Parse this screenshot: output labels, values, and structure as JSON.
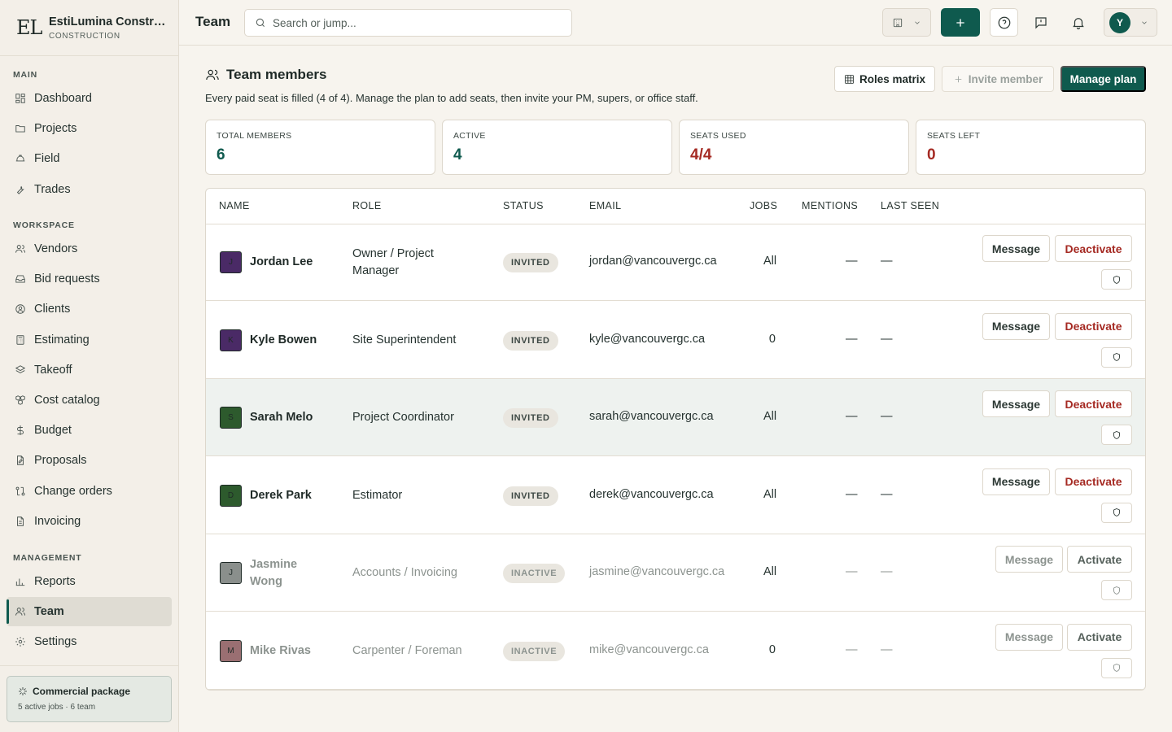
{
  "brand": {
    "logo": "EL",
    "name": "EstiLumina Construction",
    "sub": "CONSTRUCTION"
  },
  "sidebar": {
    "sections": [
      {
        "label": "MAIN",
        "items": [
          {
            "label": "Dashboard",
            "icon": "grid-icon"
          },
          {
            "label": "Projects",
            "icon": "folder-icon"
          },
          {
            "label": "Field",
            "icon": "hard-hat-icon"
          },
          {
            "label": "Trades",
            "icon": "wrench-icon"
          }
        ]
      },
      {
        "label": "WORKSPACE",
        "items": [
          {
            "label": "Vendors",
            "icon": "users-icon"
          },
          {
            "label": "Bid requests",
            "icon": "inbox-icon"
          },
          {
            "label": "Clients",
            "icon": "user-circle-icon"
          },
          {
            "label": "Estimating",
            "icon": "calculator-icon"
          },
          {
            "label": "Takeoff",
            "icon": "layers-icon"
          },
          {
            "label": "Cost catalog",
            "icon": "boxes-icon"
          },
          {
            "label": "Budget",
            "icon": "dollar-icon"
          },
          {
            "label": "Proposals",
            "icon": "file-pen-icon"
          },
          {
            "label": "Change orders",
            "icon": "git-compare-icon"
          },
          {
            "label": "Invoicing",
            "icon": "file-text-icon"
          }
        ]
      },
      {
        "label": "MANAGEMENT",
        "items": [
          {
            "label": "Reports",
            "icon": "bar-chart-icon"
          },
          {
            "label": "Team",
            "icon": "users-icon",
            "active": true
          },
          {
            "label": "Settings",
            "icon": "gear-icon"
          }
        ]
      }
    ],
    "package": {
      "title": "Commercial package",
      "sub": "5 active jobs · 6 team"
    }
  },
  "topbar": {
    "title": "Team",
    "search_placeholder": "Search or jump...",
    "user_initial": "Y"
  },
  "page": {
    "title": "Team members",
    "description": "Every paid seat is filled (4 of 4). Manage the plan to add seats, then invite your PM, supers, or office staff.",
    "roles_label": "Roles matrix",
    "invite_label": "Invite member",
    "manage_label": "Manage plan"
  },
  "stats": [
    {
      "label": "TOTAL MEMBERS",
      "value": "6",
      "color": "#0f5a4e"
    },
    {
      "label": "ACTIVE",
      "value": "4",
      "color": "#0f5a4e"
    },
    {
      "label": "SEATS USED",
      "value": "4/4",
      "color": "#a52a23"
    },
    {
      "label": "SEATS LEFT",
      "value": "0",
      "color": "#a52a23"
    }
  ],
  "table": {
    "headers": {
      "name": "NAME",
      "role": "ROLE",
      "status": "STATUS",
      "email": "EMAIL",
      "jobs": "JOBS",
      "mentions": "MENTIONS",
      "last_seen": "LAST SEEN"
    },
    "rows": [
      {
        "initial": "J",
        "name": "Jordan Lee",
        "role": "Owner / Project Manager",
        "status": "INVITED",
        "email": "jordan@vancouvergc.ca",
        "jobs": "All",
        "mentions": "—",
        "last_seen": "—",
        "message": "Message",
        "action": "Deactivate",
        "avatar_color": "#4a2a66"
      },
      {
        "initial": "K",
        "name": "Kyle Bowen",
        "role": "Site Superintendent",
        "status": "INVITED",
        "email": "kyle@vancouvergc.ca",
        "jobs": "0",
        "mentions": "—",
        "last_seen": "—",
        "message": "Message",
        "action": "Deactivate",
        "avatar_color": "#4a2a66"
      },
      {
        "initial": "S",
        "name": "Sarah Melo",
        "role": "Project Coordinator",
        "status": "INVITED",
        "email": "sarah@vancouvergc.ca",
        "jobs": "All",
        "mentions": "—",
        "last_seen": "—",
        "message": "Message",
        "action": "Deactivate",
        "avatar_color": "#2d5a2d"
      },
      {
        "initial": "D",
        "name": "Derek Park",
        "role": "Estimator",
        "status": "INVITED",
        "email": "derek@vancouvergc.ca",
        "jobs": "All",
        "mentions": "—",
        "last_seen": "—",
        "message": "Message",
        "action": "Deactivate",
        "avatar_color": "#2d5a2d"
      },
      {
        "initial": "J",
        "name": "Jasmine Wong",
        "role": "Accounts / Invoicing",
        "status": "INACTIVE",
        "email": "jasmine@vancouvergc.ca",
        "jobs": "All",
        "mentions": "—",
        "last_seen": "—",
        "message": "Message",
        "action": "Activate",
        "avatar_color": "#8a8f8c"
      },
      {
        "initial": "M",
        "name": "Mike Rivas",
        "role": "Carpenter / Foreman",
        "status": "INACTIVE",
        "email": "mike@vancouvergc.ca",
        "jobs": "0",
        "mentions": "—",
        "last_seen": "—",
        "message": "Message",
        "action": "Activate",
        "avatar_color": "#9a6f72"
      }
    ]
  }
}
